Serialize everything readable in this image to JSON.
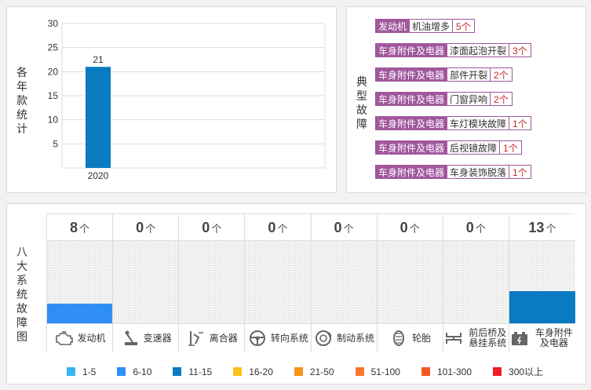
{
  "yearly_panel": {
    "title": "各年款统计"
  },
  "chart_data": {
    "type": "bar",
    "categories": [
      "2020"
    ],
    "values": [
      21
    ],
    "ylim": [
      0,
      30
    ],
    "yticks": [
      5,
      10,
      15,
      20,
      25,
      30
    ],
    "grid": true,
    "bar_color": "#0a7bc1"
  },
  "faults_panel": {
    "title": "典型故障",
    "items": [
      {
        "category": "发动机",
        "name": "机油增多",
        "count": "5个"
      },
      {
        "category": "车身附件及电器",
        "name": "漆面起泡开裂",
        "count": "3个"
      },
      {
        "category": "车身附件及电器",
        "name": "部件开裂",
        "count": "2个"
      },
      {
        "category": "车身附件及电器",
        "name": "门窗异响",
        "count": "2个"
      },
      {
        "category": "车身附件及电器",
        "name": "车灯模块故障",
        "count": "1个"
      },
      {
        "category": "车身附件及电器",
        "name": "后视镜故障",
        "count": "1个"
      },
      {
        "category": "车身附件及电器",
        "name": "车身装饰脱落",
        "count": "1个"
      }
    ]
  },
  "systems_panel": {
    "title": "八大系统故障图",
    "unit": "个",
    "systems": [
      {
        "name": "发动机",
        "count": 8,
        "icon": "engine-icon",
        "color": "#2f8ef5"
      },
      {
        "name": "变速器",
        "count": 0,
        "icon": "gear-shift-icon",
        "color": ""
      },
      {
        "name": "离合器",
        "count": 0,
        "icon": "clutch-pedal-icon",
        "color": ""
      },
      {
        "name": "转向系统",
        "count": 0,
        "icon": "steering-wheel-icon",
        "color": ""
      },
      {
        "name": "制动系统",
        "count": 0,
        "icon": "brake-disc-icon",
        "color": ""
      },
      {
        "name": "轮胎",
        "count": 0,
        "icon": "tire-icon",
        "color": ""
      },
      {
        "name": "前后桥及悬挂系统",
        "count": 0,
        "icon": "axle-icon",
        "color": ""
      },
      {
        "name": "车身附件及电器",
        "count": 13,
        "icon": "car-battery-icon",
        "color": "#0a7bc1"
      }
    ],
    "legend": [
      {
        "label": "1-5",
        "color": "#35b6f2"
      },
      {
        "label": "6-10",
        "color": "#2f8ef5"
      },
      {
        "label": "11-15",
        "color": "#0a7bc1"
      },
      {
        "label": "16-20",
        "color": "#f8c21a"
      },
      {
        "label": "21-50",
        "color": "#f7941d"
      },
      {
        "label": "51-100",
        "color": "#f7762a"
      },
      {
        "label": "101-300",
        "color": "#f25822"
      },
      {
        "label": "300以上",
        "color": "#ee1c24"
      }
    ]
  }
}
